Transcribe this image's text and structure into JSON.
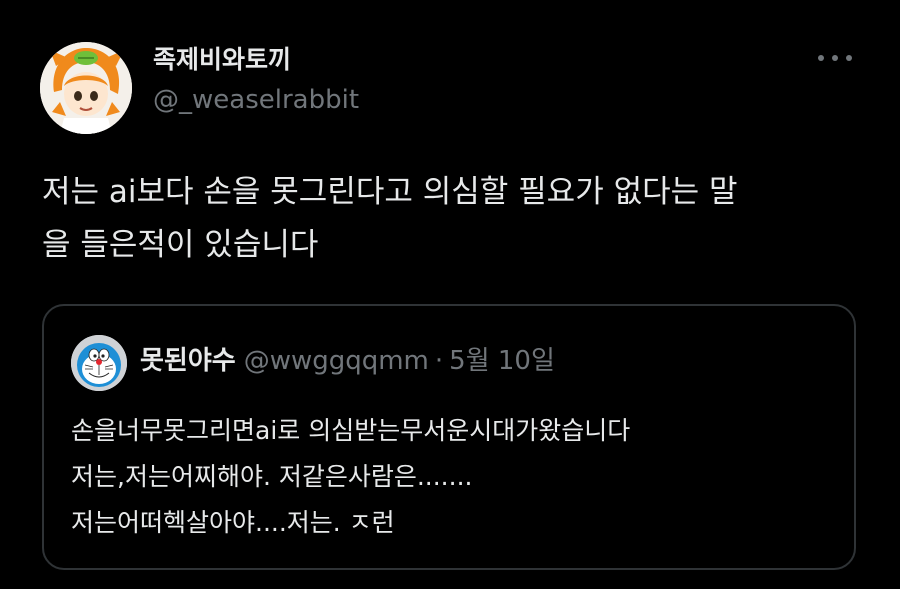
{
  "tweet": {
    "author": {
      "display_name": "족제비와토끼",
      "handle": "@_weaselrabbit",
      "avatar_icon": "orange-haired-anime-character-avatar"
    },
    "more_icon": "more-options-icon",
    "text_lines": [
      "저는 ai보다 손을 못그린다고 의심할 필요가 없다는 말",
      "을 들은적이 있습니다"
    ]
  },
  "quote": {
    "author": {
      "display_name": "못된야수",
      "handle": "@wwggqqmm",
      "avatar_icon": "doraemon-avatar"
    },
    "separator": "·",
    "date": "5월 10일",
    "text_lines": [
      "손을너무못그리면ai로 의심받는무서운시대가왔습니다",
      "저는,저는어찌해야. 저같은사람은.......",
      "저는어떠헥살아야....저는. ㅈ런"
    ]
  },
  "colors": {
    "background": "#000000",
    "primary_text": "#e7e9ea",
    "secondary_text": "#71767b",
    "border": "#2f3336"
  }
}
